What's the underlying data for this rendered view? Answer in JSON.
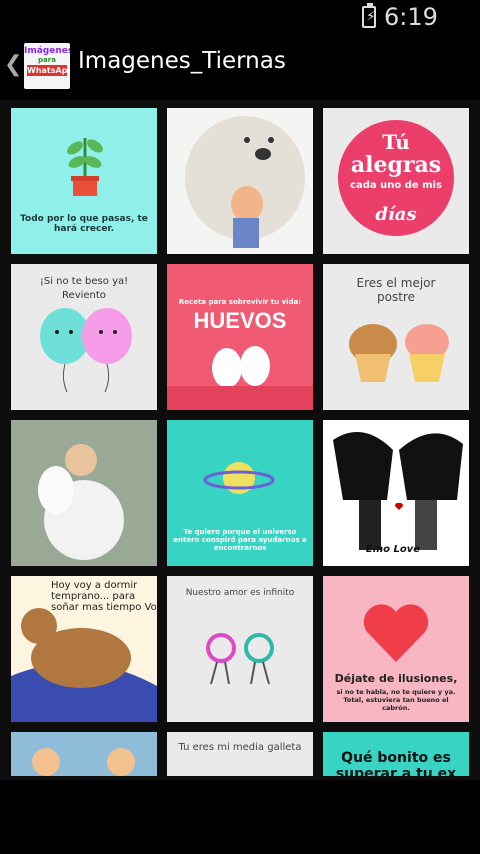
{
  "status": {
    "time": "6:19 PM"
  },
  "app": {
    "title": "Imagenes_Tiernas",
    "logo_text": [
      "Imágenes",
      "para",
      "WhatsApp"
    ]
  },
  "tiles": {
    "t1": "Todo por lo que pasas, te hará crecer.",
    "t3a": "Tú",
    "t3b": "alegras",
    "t3c": "cada uno de mis",
    "t3d": "días",
    "t4a": "¡Si no te beso ya!",
    "t4b": "Reviento",
    "t5a": "Receta para sobrevivir tu vida:",
    "t5b": "HUEVOS",
    "t6a": "Eres el mejor",
    "t6b": "postre",
    "t8": "Te quiero porque el universo entero conspiró para ayudarnos a encontrarnos",
    "t9": "Emo Love",
    "t10": "Hoy voy a dormir temprano... para soñar mas tiempo Vo",
    "t11": "Nuestro amor es infinito",
    "t12a": "Déjate de ilusiones,",
    "t12b": "si no te habla, no te quiere y ya. Total, estuviera tan bueno el cabrón.",
    "t14": "Tu eres mi media galleta",
    "t15": "Qué bonito es superar a tu ex"
  },
  "colors": {
    "mint": "#8ff0ea",
    "coral": "#f05a72",
    "teal": "#37d3c3",
    "pink": "#f7b6c2",
    "light": "#eaeaea"
  }
}
